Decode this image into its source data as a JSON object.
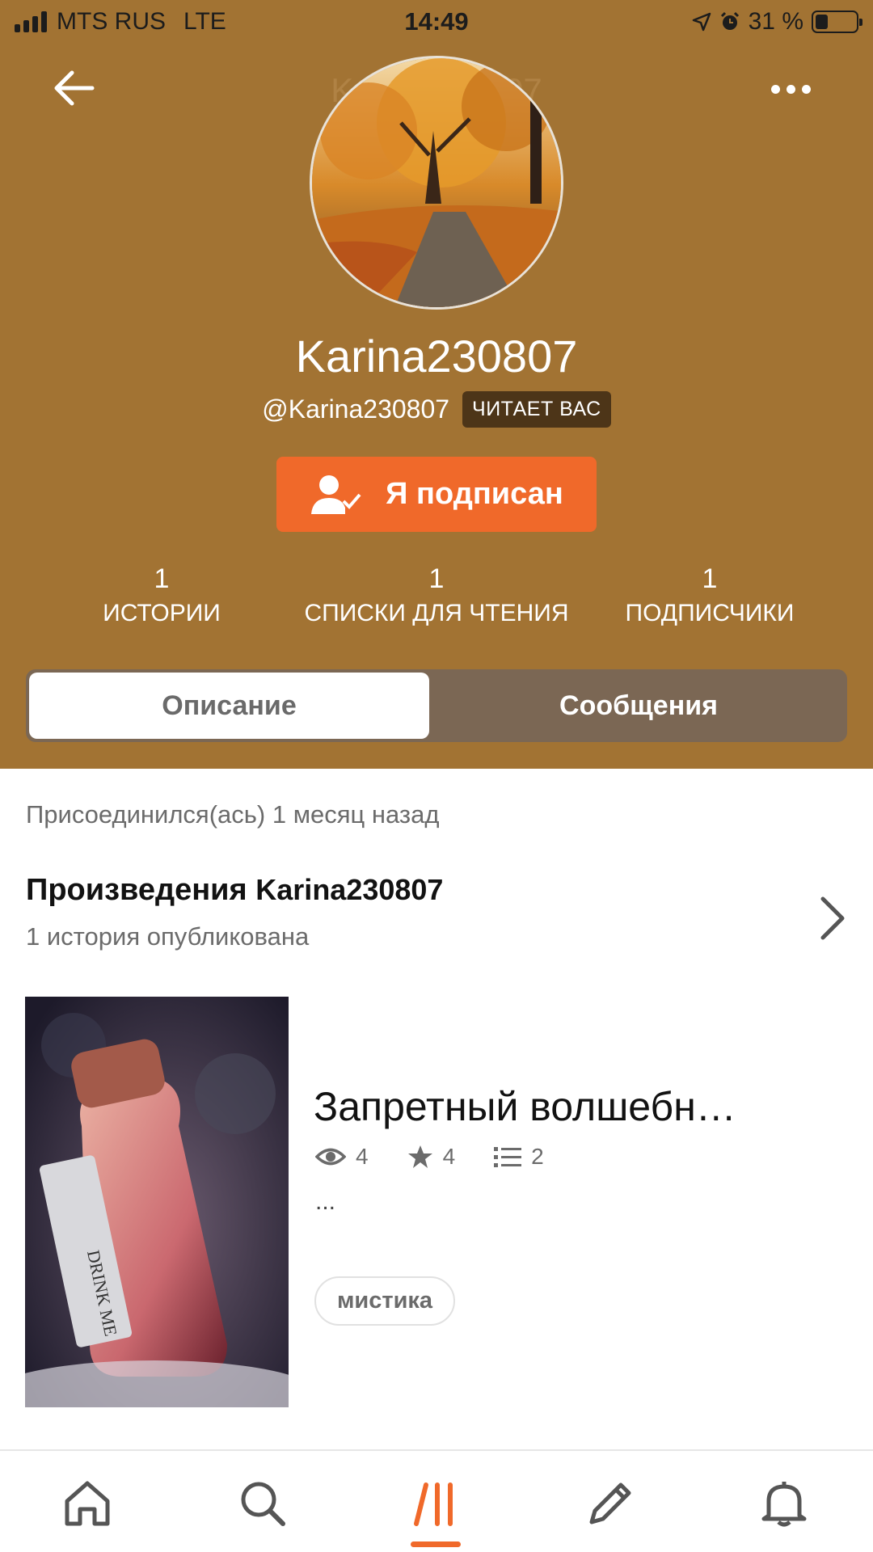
{
  "status_bar": {
    "carrier": "MTS RUS",
    "network": "LTE",
    "time": "14:49",
    "battery": "31 %",
    "battery_level": 0.31
  },
  "header": {
    "ghost_title": "Karina230807",
    "username": "Karina230807",
    "handle": "@Karina230807",
    "badge": "ЧИТАЕТ ВАС",
    "follow_button": "Я подписан"
  },
  "stats": [
    {
      "value": "1",
      "label": "ИСТОРИИ"
    },
    {
      "value": "1",
      "label": "СПИСКИ ДЛЯ ЧТЕНИЯ"
    },
    {
      "value": "1",
      "label": "ПОДПИСЧИКИ"
    }
  ],
  "tabs": {
    "active": "Описание",
    "inactive": "Сообщения"
  },
  "profile": {
    "joined": "Присоединился(ась) 1 месяц назад",
    "works_title": "Произведения",
    "works_name": "Karina230807",
    "works_sub": "1 история опубликована"
  },
  "story": {
    "title": "Запретный волшебн…",
    "views": "4",
    "votes": "4",
    "parts": "2",
    "description": "...",
    "tag": "мистика"
  },
  "colors": {
    "header_bg": "#a27333",
    "accent": "#f0692a",
    "tabs_bg": "#7b6754"
  },
  "icons": [
    "back-arrow-icon",
    "more-icon",
    "user-check-icon",
    "eye-icon",
    "star-icon",
    "list-icon",
    "chevron-right-icon",
    "home-icon",
    "search-icon",
    "library-icon",
    "pencil-icon",
    "bell-icon"
  ]
}
